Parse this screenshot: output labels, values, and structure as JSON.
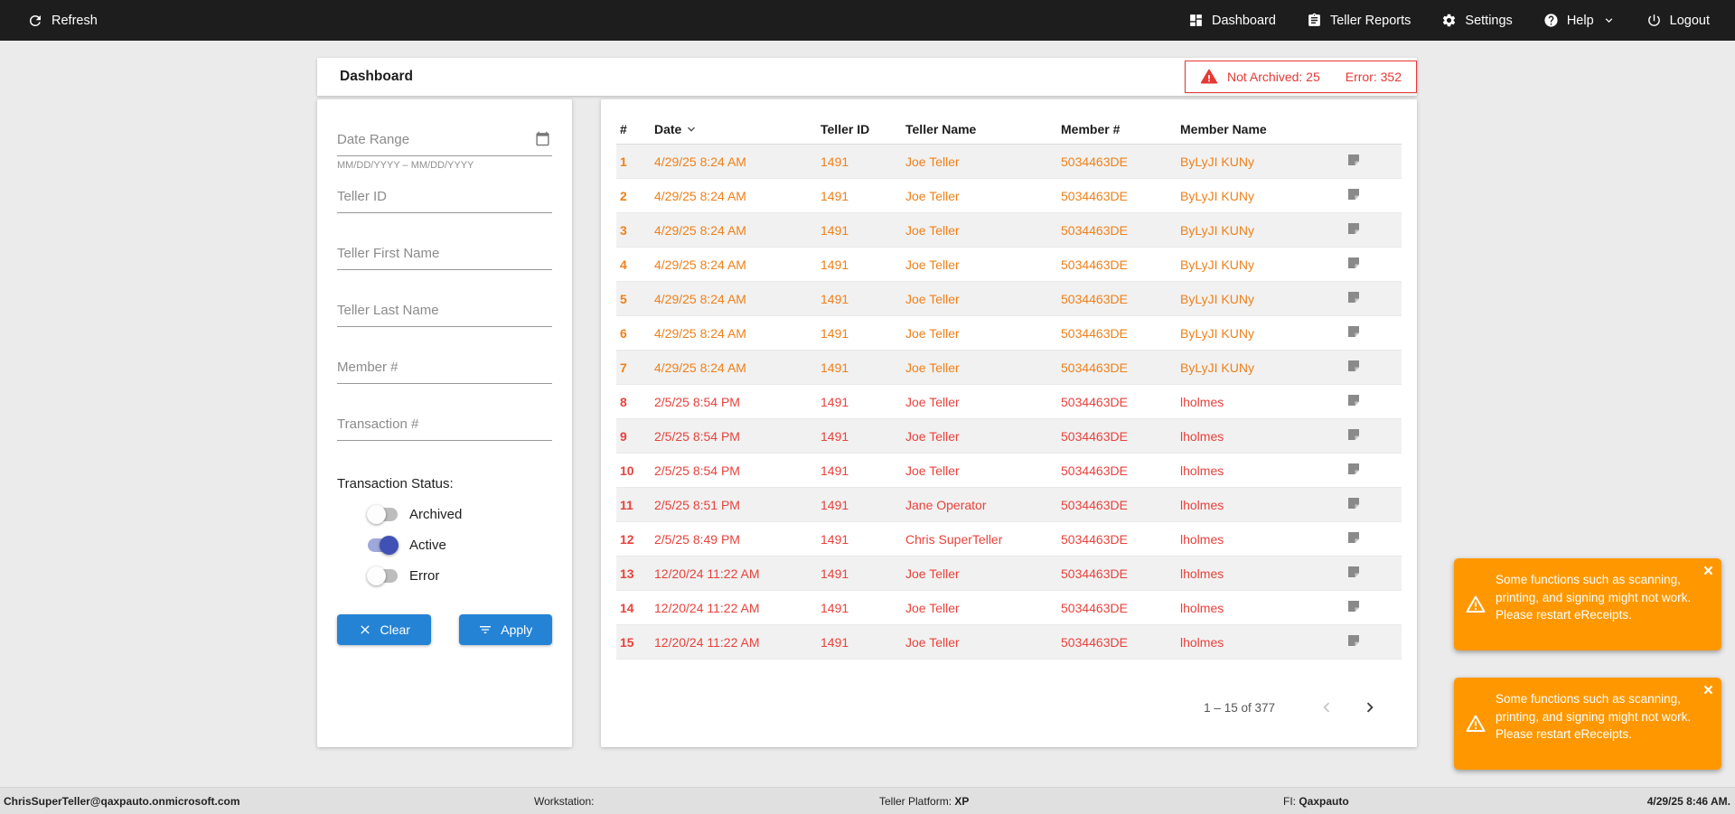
{
  "colors": {
    "accent_blue": "#2583d5",
    "row_orange": "#ef8019",
    "row_red": "#e8423c",
    "toast_orange": "#ff9800",
    "alert_red": "#e53935",
    "navbar_bg": "#1d1d1d"
  },
  "icons": {
    "refresh-icon": "⟳",
    "dashboard-icon": "▦",
    "teller-reports-icon": "▤",
    "settings-icon": "⚙",
    "help-icon": "?",
    "chevron-down-icon": "⌄",
    "logout-icon": "⏻",
    "calendar-icon": "▦",
    "warning-icon": "⚠",
    "clear-icon": "✕",
    "filter-icon": "≡",
    "receipt-icon": "▤",
    "sort-desc-icon": "⌄",
    "chevron-left-icon": "‹",
    "chevron-right-icon": "›",
    "close-icon": "×"
  },
  "navbar": {
    "refresh_label": "Refresh",
    "dashboard_label": "Dashboard",
    "teller_reports_label": "Teller Reports",
    "settings_label": "Settings",
    "help_label": "Help",
    "logout_label": "Logout"
  },
  "header": {
    "title": "Dashboard",
    "alert_not_archived": "Not Archived: 25",
    "alert_error": "Error: 352"
  },
  "filters": {
    "date_range_placeholder": "Date Range",
    "date_range_hint": "MM/DD/YYYY – MM/DD/YYYY",
    "teller_id_placeholder": "Teller ID",
    "teller_first_name_placeholder": "Teller First Name",
    "teller_last_name_placeholder": "Teller Last Name",
    "member_placeholder": "Member #",
    "transaction_placeholder": "Transaction #",
    "status_label": "Transaction Status:",
    "toggles": [
      {
        "label": "Archived",
        "on": false
      },
      {
        "label": "Active",
        "on": true
      },
      {
        "label": "Error",
        "on": false
      }
    ],
    "clear_label": "Clear",
    "apply_label": "Apply"
  },
  "table": {
    "columns": [
      "#",
      "Date",
      "Teller ID",
      "Teller Name",
      "Member #",
      "Member Name"
    ],
    "rows": [
      {
        "num": "1",
        "date": "4/29/25 8:24 AM",
        "teller_id": "1491",
        "teller_name": "Joe Teller",
        "member": "5034463DE",
        "member_name": "ByLyJI KUNy",
        "status": "orange"
      },
      {
        "num": "2",
        "date": "4/29/25 8:24 AM",
        "teller_id": "1491",
        "teller_name": "Joe Teller",
        "member": "5034463DE",
        "member_name": "ByLyJI KUNy",
        "status": "orange"
      },
      {
        "num": "3",
        "date": "4/29/25 8:24 AM",
        "teller_id": "1491",
        "teller_name": "Joe Teller",
        "member": "5034463DE",
        "member_name": "ByLyJI KUNy",
        "status": "orange"
      },
      {
        "num": "4",
        "date": "4/29/25 8:24 AM",
        "teller_id": "1491",
        "teller_name": "Joe Teller",
        "member": "5034463DE",
        "member_name": "ByLyJI KUNy",
        "status": "orange"
      },
      {
        "num": "5",
        "date": "4/29/25 8:24 AM",
        "teller_id": "1491",
        "teller_name": "Joe Teller",
        "member": "5034463DE",
        "member_name": "ByLyJI KUNy",
        "status": "orange"
      },
      {
        "num": "6",
        "date": "4/29/25 8:24 AM",
        "teller_id": "1491",
        "teller_name": "Joe Teller",
        "member": "5034463DE",
        "member_name": "ByLyJI KUNy",
        "status": "orange"
      },
      {
        "num": "7",
        "date": "4/29/25 8:24 AM",
        "teller_id": "1491",
        "teller_name": "Joe Teller",
        "member": "5034463DE",
        "member_name": "ByLyJI KUNy",
        "status": "orange"
      },
      {
        "num": "8",
        "date": "2/5/25 8:54 PM",
        "teller_id": "1491",
        "teller_name": "Joe Teller",
        "member": "5034463DE",
        "member_name": "lholmes",
        "status": "red"
      },
      {
        "num": "9",
        "date": "2/5/25 8:54 PM",
        "teller_id": "1491",
        "teller_name": "Joe Teller",
        "member": "5034463DE",
        "member_name": "lholmes",
        "status": "red"
      },
      {
        "num": "10",
        "date": "2/5/25 8:54 PM",
        "teller_id": "1491",
        "teller_name": "Joe Teller",
        "member": "5034463DE",
        "member_name": "lholmes",
        "status": "red"
      },
      {
        "num": "11",
        "date": "2/5/25 8:51 PM",
        "teller_id": "1491",
        "teller_name": "Jane Operator",
        "member": "5034463DE",
        "member_name": "lholmes",
        "status": "red"
      },
      {
        "num": "12",
        "date": "2/5/25 8:49 PM",
        "teller_id": "1491",
        "teller_name": "Chris SuperTeller",
        "member": "5034463DE",
        "member_name": "lholmes",
        "status": "red"
      },
      {
        "num": "13",
        "date": "12/20/24 11:22 AM",
        "teller_id": "1491",
        "teller_name": "Joe Teller",
        "member": "5034463DE",
        "member_name": "lholmes",
        "status": "red"
      },
      {
        "num": "14",
        "date": "12/20/24 11:22 AM",
        "teller_id": "1491",
        "teller_name": "Joe Teller",
        "member": "5034463DE",
        "member_name": "lholmes",
        "status": "red"
      },
      {
        "num": "15",
        "date": "12/20/24 11:22 AM",
        "teller_id": "1491",
        "teller_name": "Joe Teller",
        "member": "5034463DE",
        "member_name": "lholmes",
        "status": "red"
      }
    ],
    "pagination": "1 – 15 of 377"
  },
  "toasts": [
    {
      "message": "Some functions such as scanning, printing, and signing might not work. Please restart eReceipts."
    },
    {
      "message": "Some functions such as scanning, printing, and signing might not work. Please restart eReceipts."
    }
  ],
  "footer": {
    "user": "ChrisSuperTeller@qaxpauto.onmicrosoft.com",
    "workstation_label": "Workstation:",
    "teller_platform_label": "Teller Platform:",
    "teller_platform_value": "XP",
    "fi_label": "FI:",
    "fi_value": "Qaxpauto",
    "datetime": "4/29/25 8:46 AM."
  }
}
